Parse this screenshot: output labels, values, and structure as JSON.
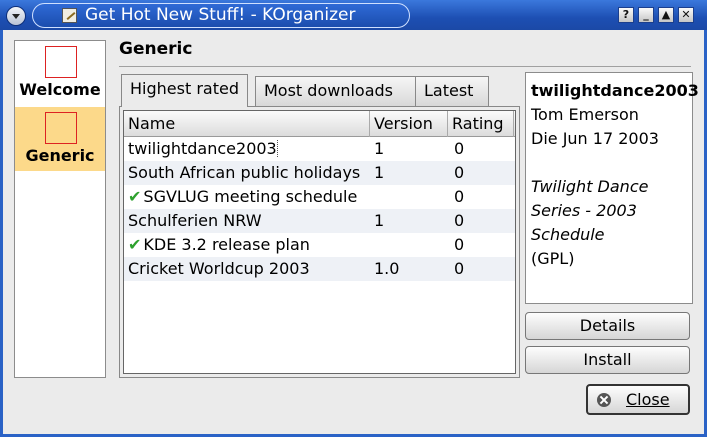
{
  "window": {
    "title": "Get Hot New Stuff! - KOrganizer",
    "buttons": [
      "?",
      "_",
      "▲",
      "✕"
    ]
  },
  "sidebar": {
    "items": [
      {
        "label": "Welcome"
      },
      {
        "label": "Generic",
        "selected": true
      }
    ]
  },
  "page": {
    "title": "Generic"
  },
  "tabs": [
    {
      "label": "Highest rated",
      "active": true
    },
    {
      "label": "Most downloads"
    },
    {
      "label": "Latest"
    }
  ],
  "table": {
    "columns": [
      "Name",
      "Version",
      "Rating"
    ],
    "rows": [
      {
        "name": "twilightdance2003",
        "version": "1",
        "rating": "0",
        "installed": false
      },
      {
        "name": "South African public holidays",
        "version": "1",
        "rating": "0",
        "installed": false
      },
      {
        "name": "SGVLUG meeting schedule",
        "version": "",
        "rating": "0",
        "installed": true
      },
      {
        "name": "Schulferien NRW",
        "version": "1",
        "rating": "0",
        "installed": false
      },
      {
        "name": "KDE 3.2 release plan",
        "version": "",
        "rating": "0",
        "installed": true
      },
      {
        "name": "Cricket Worldcup 2003",
        "version": "1.0",
        "rating": "0",
        "installed": false
      }
    ]
  },
  "info": {
    "name": "twilightdance2003",
    "author": "Tom Emerson",
    "date": "Die Jun 17 2003",
    "summary": "Twilight Dance Series - 2003 Schedule",
    "license": "(GPL)"
  },
  "buttons": {
    "details": "Details",
    "install": "Install",
    "close": "Close"
  },
  "colors": {
    "titlebar": "#1d4fb3",
    "selected_sidebar": "#fcd98a",
    "check": "#2ea12e"
  }
}
